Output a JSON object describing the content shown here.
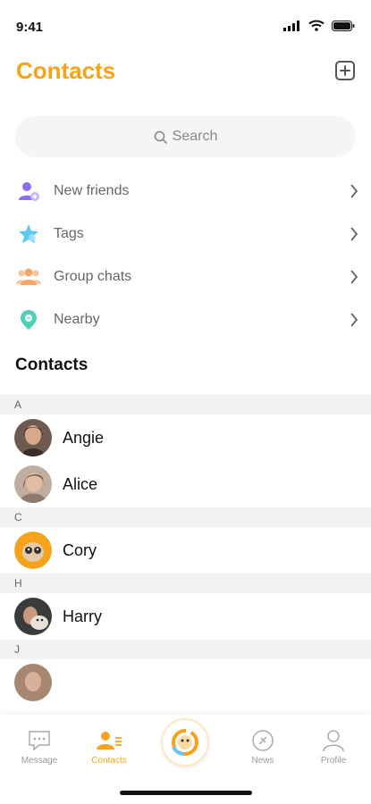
{
  "status_bar": {
    "time": "9:41"
  },
  "header": {
    "title": "Contacts"
  },
  "search": {
    "placeholder": "Search"
  },
  "menu": [
    {
      "label": "New friends",
      "icon": "add-person-icon",
      "color": "#8C6CF2"
    },
    {
      "label": "Tags",
      "icon": "star-icon",
      "color": "#5EC8F2"
    },
    {
      "label": "Group chats",
      "icon": "group-icon",
      "color": "#F7A56B"
    },
    {
      "label": "Nearby",
      "icon": "location-pin-icon",
      "color": "#4FD1B5"
    }
  ],
  "contacts_section": {
    "title": "Contacts"
  },
  "groups": [
    {
      "letter": "A",
      "contacts": [
        "Angie",
        "Alice"
      ]
    },
    {
      "letter": "C",
      "contacts": [
        "Cory"
      ]
    },
    {
      "letter": "H",
      "contacts": [
        "Harry"
      ]
    },
    {
      "letter": "J",
      "contacts": []
    }
  ],
  "tabbar": {
    "tabs": [
      {
        "label": "Message",
        "icon": "message-icon",
        "active": false
      },
      {
        "label": "Contacts",
        "icon": "contacts-icon",
        "active": true
      },
      {
        "label": "News",
        "icon": "news-icon",
        "active": false
      },
      {
        "label": "Profile",
        "icon": "profile-icon",
        "active": false
      }
    ]
  },
  "colors": {
    "accent": "#F5A31A",
    "muted": "#999999",
    "group_bg": "#F2F2F2"
  }
}
